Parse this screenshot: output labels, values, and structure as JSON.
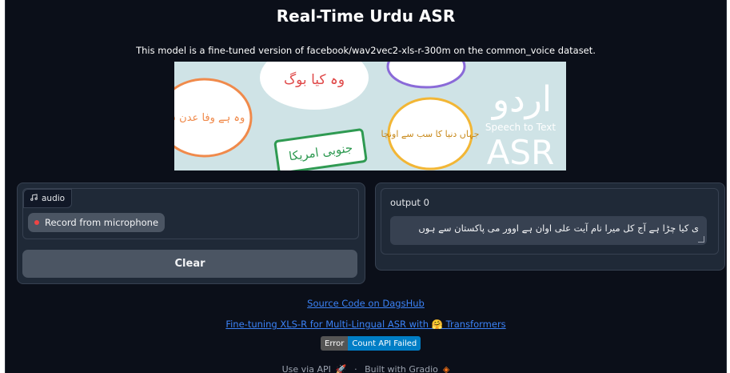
{
  "header": {
    "title": "Real-Time Urdu ASR",
    "description": "This model is a fine-tuned version of facebook/wav2vec2-xls-r-300m on the common_voice dataset."
  },
  "banner": {
    "logo_text_urdu": "اردو",
    "logo_subtext": "Speech to Text",
    "logo_main": "ASR",
    "bubbles": [
      "وہ کیا بوگ",
      "وہ ہے وفا عدن ہو",
      "جہاں دنیا کا سب سے اونچا",
      "جنوبی امریکا"
    ]
  },
  "input": {
    "tag_label": "audio",
    "record_label": "Record from microphone",
    "clear_label": "Clear"
  },
  "output": {
    "label": "output 0",
    "text": "ی کیا چڑا ہے آج کل میرا نام آیت علی اوان ہے اوور می پاکستان سے ہوں"
  },
  "links": {
    "source": "Source Code on DagsHub",
    "tutorial": "Fine-tuning XLS-R for Multi-Lingual ASR with 🤗 Transformers"
  },
  "badge": {
    "left": "Error",
    "right": "Count API Failed"
  },
  "footer": {
    "api": "Use via API",
    "separator": "·",
    "built": "Built with Gradio"
  },
  "colors": {
    "background": "#0b0f19",
    "panel": "#1f2937",
    "accent_link": "#3b82f6",
    "badge_left": "#555555",
    "badge_right": "#007ec6",
    "recording_dot": "#ef4444"
  }
}
